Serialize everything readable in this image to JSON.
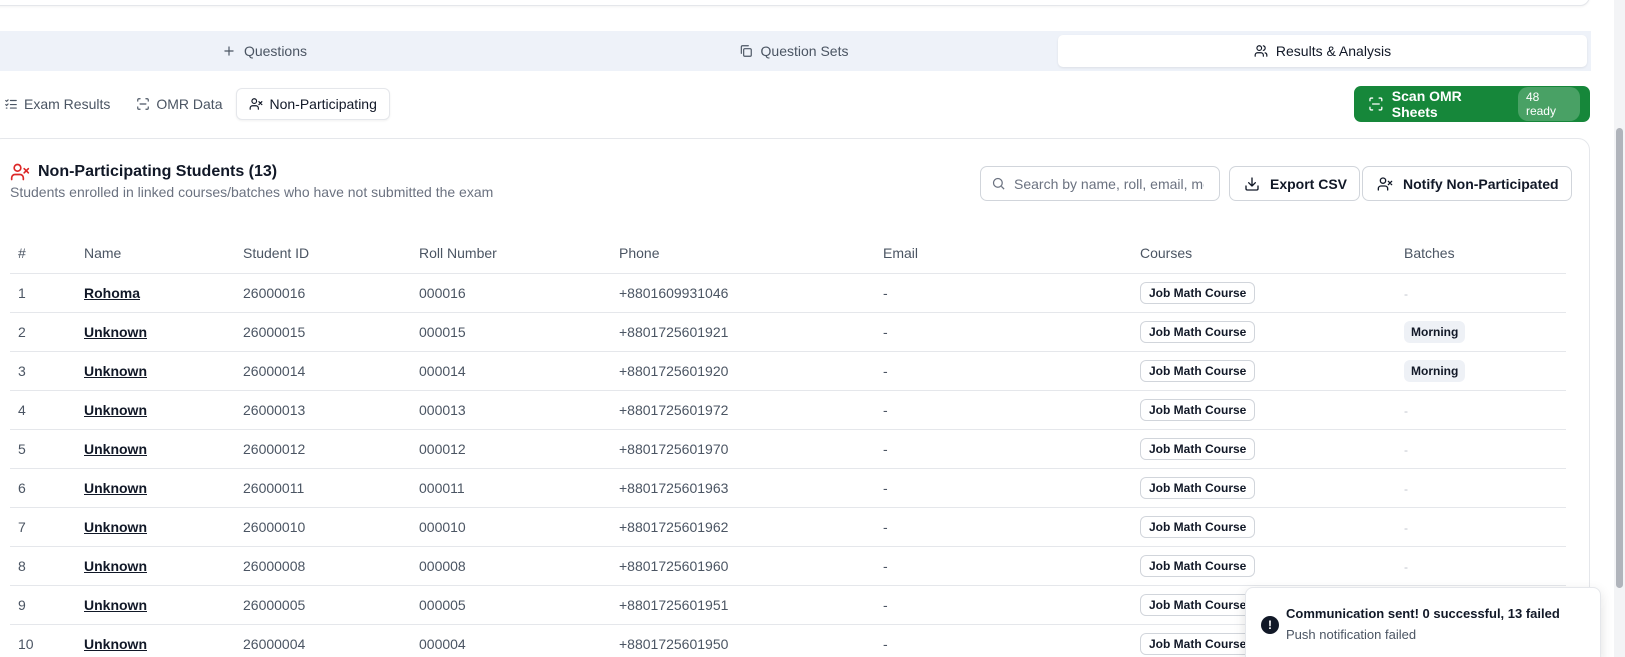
{
  "main_tabs": [
    {
      "label": "Questions",
      "icon": "plus-icon",
      "active": false
    },
    {
      "label": "Question Sets",
      "icon": "copy-icon",
      "active": false
    },
    {
      "label": "Results & Analysis",
      "icon": "users-icon",
      "active": true
    }
  ],
  "sub_tabs": [
    {
      "label": "Exam Results",
      "icon": "list-checks-icon",
      "active": false
    },
    {
      "label": "OMR Data",
      "icon": "scan-icon",
      "active": false
    },
    {
      "label": "Non-Participating",
      "icon": "user-x-icon",
      "active": true
    }
  ],
  "scan_button": {
    "label": "Scan OMR Sheets",
    "badge": "48 ready",
    "color": "#16873a"
  },
  "panel": {
    "title": "Non-Participating Students (13)",
    "subtitle": "Students enrolled in linked courses/batches who have not submitted the exam"
  },
  "search": {
    "placeholder": "Search by name, roll, email, mo",
    "value": ""
  },
  "export_button": {
    "label": "Export CSV"
  },
  "notify_button": {
    "label": "Notify Non-Participated"
  },
  "table": {
    "headers": [
      "#",
      "Name",
      "Student ID",
      "Roll Number",
      "Phone",
      "Email",
      "Courses",
      "Batches"
    ],
    "rows": [
      {
        "n": "1",
        "name": "Rohoma",
        "student_id": "26000016",
        "roll": "000016",
        "phone": "+8801609931046",
        "email": "-",
        "course": "Job Math Course",
        "batch": "-"
      },
      {
        "n": "2",
        "name": "Unknown",
        "student_id": "26000015",
        "roll": "000015",
        "phone": "+8801725601921",
        "email": "-",
        "course": "Job Math Course",
        "batch": "Morning"
      },
      {
        "n": "3",
        "name": "Unknown",
        "student_id": "26000014",
        "roll": "000014",
        "phone": "+8801725601920",
        "email": "-",
        "course": "Job Math Course",
        "batch": "Morning"
      },
      {
        "n": "4",
        "name": "Unknown",
        "student_id": "26000013",
        "roll": "000013",
        "phone": "+8801725601972",
        "email": "-",
        "course": "Job Math Course",
        "batch": "-"
      },
      {
        "n": "5",
        "name": "Unknown",
        "student_id": "26000012",
        "roll": "000012",
        "phone": "+8801725601970",
        "email": "-",
        "course": "Job Math Course",
        "batch": "-"
      },
      {
        "n": "6",
        "name": "Unknown",
        "student_id": "26000011",
        "roll": "000011",
        "phone": "+8801725601963",
        "email": "-",
        "course": "Job Math Course",
        "batch": "-"
      },
      {
        "n": "7",
        "name": "Unknown",
        "student_id": "26000010",
        "roll": "000010",
        "phone": "+8801725601962",
        "email": "-",
        "course": "Job Math Course",
        "batch": "-"
      },
      {
        "n": "8",
        "name": "Unknown",
        "student_id": "26000008",
        "roll": "000008",
        "phone": "+8801725601960",
        "email": "-",
        "course": "Job Math Course",
        "batch": "-"
      },
      {
        "n": "9",
        "name": "Unknown",
        "student_id": "26000005",
        "roll": "000005",
        "phone": "+8801725601951",
        "email": "-",
        "course": "Job Math Course",
        "batch": ""
      },
      {
        "n": "10",
        "name": "Unknown",
        "student_id": "26000004",
        "roll": "000004",
        "phone": "+8801725601950",
        "email": "-",
        "course": "Job Math Course",
        "batch": ""
      }
    ]
  },
  "toast": {
    "icon": "alert-circle-icon",
    "title": "Communication sent! 0 successful, 13 failed",
    "description": "Push notification failed"
  }
}
